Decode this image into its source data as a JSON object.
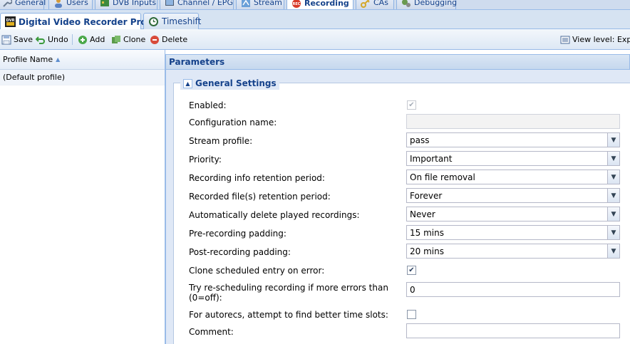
{
  "top_tabs": [
    {
      "label": "General",
      "icon": "wrench-icon"
    },
    {
      "label": "Users",
      "icon": "users-icon"
    },
    {
      "label": "DVB Inputs",
      "icon": "dvb-card-icon"
    },
    {
      "label": "Channel / EPG",
      "icon": "tv-icon"
    },
    {
      "label": "Stream",
      "icon": "stream-icon"
    },
    {
      "label": "Recording",
      "icon": "rec-icon"
    },
    {
      "label": "CAs",
      "icon": "key-icon"
    },
    {
      "label": "Debugging",
      "icon": "gears-icon"
    }
  ],
  "sub_tabs": [
    {
      "label": "Digital Video Recorder Profiles",
      "icon": "dvr-icon"
    },
    {
      "label": "Timeshift",
      "icon": "clock-icon"
    }
  ],
  "toolbar": {
    "save": "Save",
    "undo": "Undo",
    "add": "Add",
    "clone": "Clone",
    "delete": "Delete",
    "view_level": "View level: Expe"
  },
  "grid": {
    "column_header": "Profile Name",
    "rows": [
      "(Default profile)"
    ]
  },
  "panel": {
    "title": "Parameters",
    "section": "General Settings",
    "fields": {
      "enabled": {
        "label": "Enabled:",
        "checked": true
      },
      "config_name": {
        "label": "Configuration name:",
        "value": ""
      },
      "stream_profile": {
        "label": "Stream profile:",
        "value": "pass"
      },
      "priority": {
        "label": "Priority:",
        "value": "Important"
      },
      "info_retention": {
        "label": "Recording info retention period:",
        "value": "On file removal"
      },
      "file_retention": {
        "label": "Recorded file(s) retention period:",
        "value": "Forever"
      },
      "auto_delete": {
        "label": "Automatically delete played recordings:",
        "value": "Never"
      },
      "pre_padding": {
        "label": "Pre-recording padding:",
        "value": "15 mins"
      },
      "post_padding": {
        "label": "Post-recording padding:",
        "value": "20 mins"
      },
      "clone_on_error": {
        "label": "Clone scheduled entry on error:",
        "checked": true
      },
      "reschedule": {
        "label": "Try re-scheduling recording if more errors than (0=off):",
        "value": "0"
      },
      "autorec_slots": {
        "label": "For autorecs, attempt to find better time slots:",
        "checked": false
      },
      "comment": {
        "label": "Comment:",
        "value": ""
      }
    }
  },
  "colors": {
    "accent": "#15428b",
    "border": "#99bbe8",
    "toolbar_bg": "#dde8f5"
  }
}
